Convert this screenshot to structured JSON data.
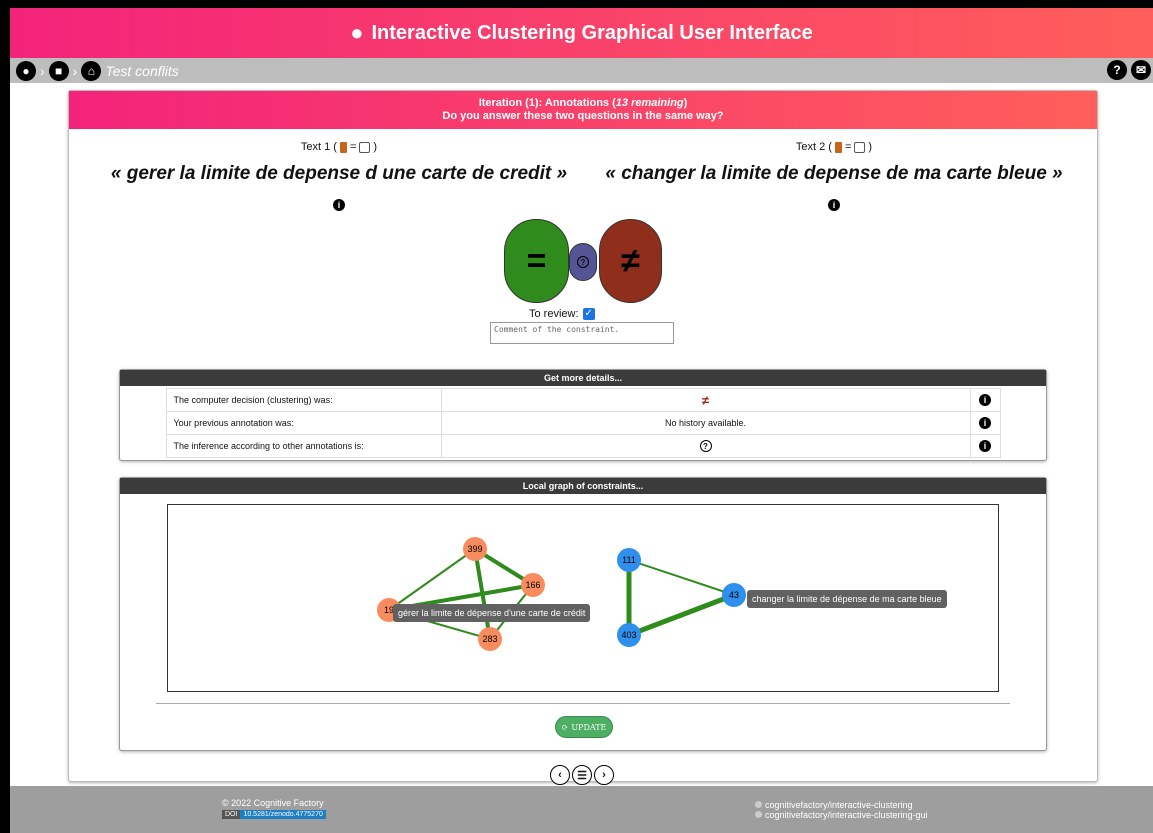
{
  "app": {
    "title": "Interactive Clustering Graphical User Interface"
  },
  "breadcrumb": {
    "current": "Test conflits"
  },
  "iteration": {
    "title_prefix": "Iteration (1): Annotations (",
    "remaining": "13 remaining",
    "title_suffix": ")",
    "question": "Do you answer these two questions in the same way?"
  },
  "text1": {
    "label_prefix": "Text 1 (",
    "label_eq": "=",
    "label_suffix": ")",
    "quote": "« gerer la limite de depense d une carte de credit »"
  },
  "text2": {
    "label_prefix": "Text 2 (",
    "label_eq": "=",
    "label_suffix": ")",
    "quote": "« changer la limite de depense de ma carte bleue »"
  },
  "annotation": {
    "must_link": "=",
    "unknown": "?",
    "cannot_link": "≠",
    "review_label": "To review:",
    "comment_placeholder": "Comment of the constraint."
  },
  "details": {
    "header": "Get more details...",
    "rows": [
      {
        "label": "The computer decision (clustering) was:",
        "value": "≠"
      },
      {
        "label": "Your previous annotation was:",
        "value": "No history available."
      },
      {
        "label": "The inference according to other annotations is:",
        "value": "?"
      }
    ]
  },
  "graph": {
    "header": "Local graph of constraints...",
    "nodes": [
      "399",
      "166",
      "19",
      "283",
      "111",
      "43",
      "403"
    ],
    "colors": {
      "cluster1": "#f88c5e",
      "cluster2": "#2f8fed",
      "edge": "#2e8b1c"
    },
    "tooltip_left": "gérer la limite de dépense d'une carte de crédit",
    "tooltip_right": "changer la limite de dépense de ma carte bleue",
    "update_label": "UPDATE"
  },
  "footer": {
    "copyright": "© 2022 Cognitive Factory",
    "doi_label": "DOI",
    "doi_value": "10.5281/zenodo.4775270",
    "repo1": "cognitivefactory/interactive-clustering",
    "repo2": "cognitivefactory/interactive-clustering-gui"
  }
}
